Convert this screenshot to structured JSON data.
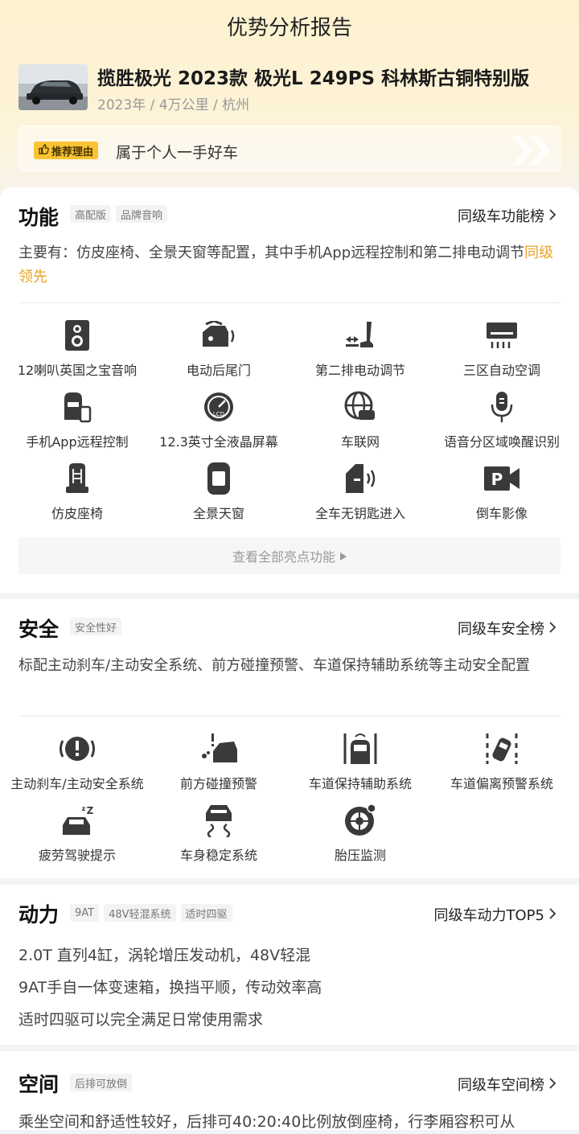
{
  "header": {
    "title": "优势分析报告",
    "car_name": "揽胜极光 2023款 极光L 249PS 科林斯古铜特别版",
    "car_meta": "2023年 / 4万公里 / 杭州",
    "reason_tag": "推荐理由",
    "reason_text": "属于个人一手好车"
  },
  "function": {
    "title": "功能",
    "tags": [
      "高配版",
      "品牌音响"
    ],
    "rank_link": "同级车功能榜",
    "desc_main": "主要有：仿皮座椅、全景天窗等配置，其中手机App远程控制和第二排电动调节",
    "desc_highlight": "同级领先",
    "features": [
      {
        "label": "12喇叭英国之宝音响",
        "icon": "speaker-icon"
      },
      {
        "label": "电动后尾门",
        "icon": "power-tailgate-icon"
      },
      {
        "label": "第二排电动调节",
        "icon": "seat-adjust-icon"
      },
      {
        "label": "三区自动空调",
        "icon": "air-conditioner-icon"
      },
      {
        "label": "手机App远程控制",
        "icon": "phone-remote-icon"
      },
      {
        "label": "12.3英寸全液晶屏幕",
        "icon": "lcd-gauge-icon"
      },
      {
        "label": "车联网",
        "icon": "globe-car-icon"
      },
      {
        "label": "语音分区域唤醒识别",
        "icon": "microphone-icon"
      },
      {
        "label": "仿皮座椅",
        "icon": "leather-seat-icon"
      },
      {
        "label": "全景天窗",
        "icon": "sunroof-icon"
      },
      {
        "label": "全车无钥匙进入",
        "icon": "keyless-entry-icon"
      },
      {
        "label": "倒车影像",
        "icon": "reverse-camera-icon"
      }
    ],
    "view_all": "查看全部亮点功能"
  },
  "safety": {
    "title": "安全",
    "tags": [
      "安全性好"
    ],
    "rank_link": "同级车安全榜",
    "desc": "标配主动刹车/主动安全系统、前方碰撞预警、车道保持辅助系统等主动安全配置",
    "features": [
      {
        "label": "主动刹车/主动安全系统",
        "icon": "brake-warning-icon"
      },
      {
        "label": "前方碰撞预警",
        "icon": "collision-warning-icon"
      },
      {
        "label": "车道保持辅助系统",
        "icon": "lane-keep-icon"
      },
      {
        "label": "车道偏离预警系统",
        "icon": "lane-departure-icon"
      },
      {
        "label": "疲劳驾驶提示",
        "icon": "fatigue-icon"
      },
      {
        "label": "车身稳定系统",
        "icon": "stability-icon"
      },
      {
        "label": "胎压监测",
        "icon": "tire-pressure-icon"
      }
    ]
  },
  "power": {
    "title": "动力",
    "tags": [
      "9AT",
      "48V轻混系统",
      "适时四驱"
    ],
    "rank_link": "同级车动力TOP5",
    "lines": [
      "2.0T 直列4缸，涡轮增压发动机，48V轻混",
      "9AT手自一体变速箱，换挡平顺，传动效率高",
      "适时四驱可以完全满足日常使用需求"
    ]
  },
  "space": {
    "title": "空间",
    "tags": [
      "后排可放倒"
    ],
    "rank_link": "同级车空间榜",
    "desc": "乘坐空间和舒适性较好，后排可40:20:40比例放倒座椅，行李厢容积可从"
  },
  "colors": {
    "accent": "#f8c434",
    "highlight": "#e6a422",
    "icon": "#3a3a3a"
  }
}
